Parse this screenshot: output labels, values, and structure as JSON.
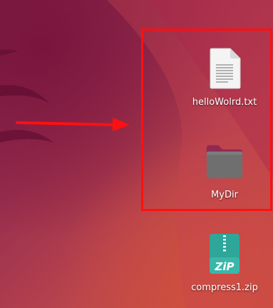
{
  "desktop": {
    "icons": [
      {
        "label": "helloWolrd.txt",
        "icon": "text-file-icon"
      },
      {
        "label": "MyDir",
        "icon": "folder-icon"
      },
      {
        "label": "compress1.zip",
        "icon": "zip-archive-icon"
      }
    ],
    "zip_badge_text": "ZiP"
  },
  "annotations": {
    "highlight_color": "#ff1010",
    "arrow_color": "#ff1010"
  }
}
